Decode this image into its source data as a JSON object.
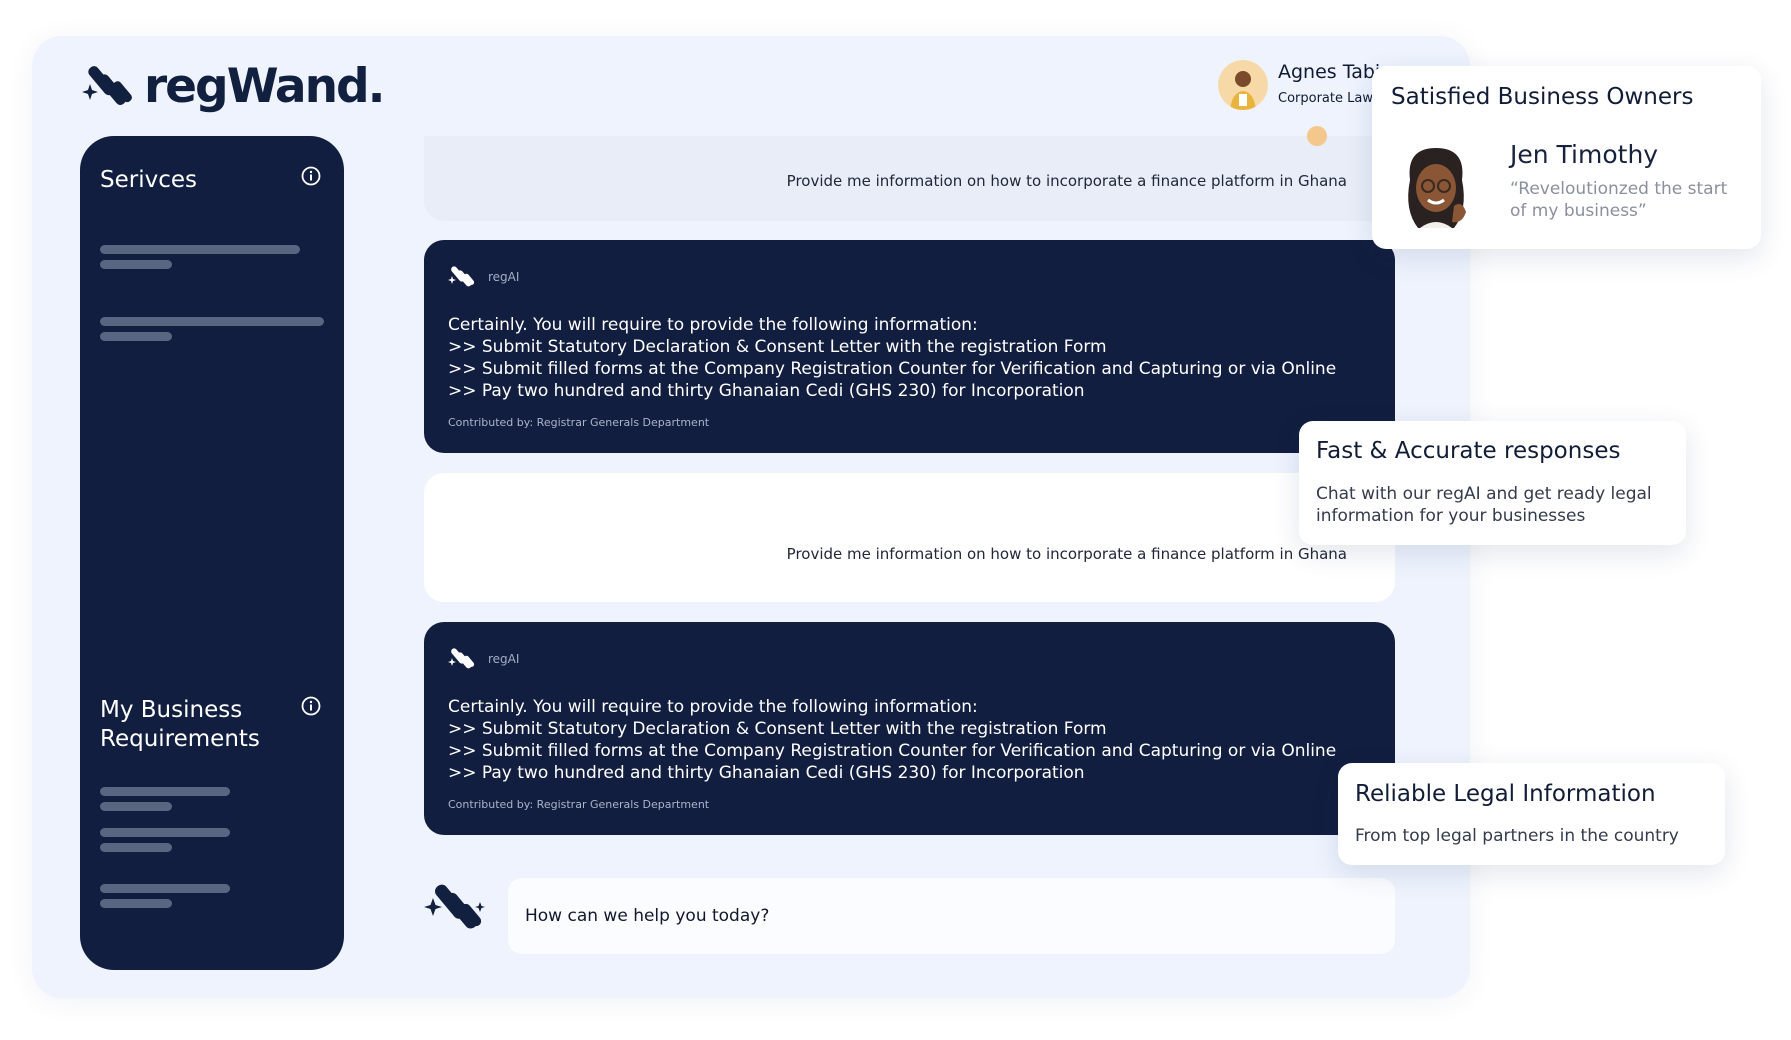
{
  "brand": {
    "name": "regWand."
  },
  "user": {
    "name": "Agnes Tabi",
    "role": "Corporate Lawyer"
  },
  "sidebar": {
    "services_title": "Serivces",
    "requirements_title_line1": "My Business",
    "requirements_title_line2": "Requirements"
  },
  "chat": {
    "user_question": "Provide me information on how to incorporate a finance platform in Ghana",
    "ai_name": "regAI",
    "ai_lines": [
      "Certainly. You will require to provide the following information:",
      ">> Submit Statutory Declaration & Consent Letter with the registration Form",
      ">> Submit filled forms at the Company Registration Counter for Verification and Capturing or via Online",
      ">> Pay two hundred and thirty Ghanaian Cedi (GHS 230) for Incorporation"
    ],
    "contributor": "Contributed by: Registrar Generals Department",
    "input_placeholder": "How can we help you today?"
  },
  "cards": {
    "testimonial": {
      "title": "Satisfied Business Owners",
      "name": "Jen Timothy",
      "quote": "“Reveloutionzed the start of my business”"
    },
    "fast": {
      "title": "Fast & Accurate responses",
      "text": "Chat with our regAI and get ready legal information for your businesses"
    },
    "reliable": {
      "title": "Reliable Legal Information",
      "text": "From top legal partners in the country"
    }
  },
  "icons": {
    "logo": "regwand-logo-icon",
    "info": "info-icon",
    "chat": "regai-sparkle-icon"
  },
  "colors": {
    "navy": "#121e3f",
    "panel": "#eef3fd",
    "text": "#111c36"
  }
}
